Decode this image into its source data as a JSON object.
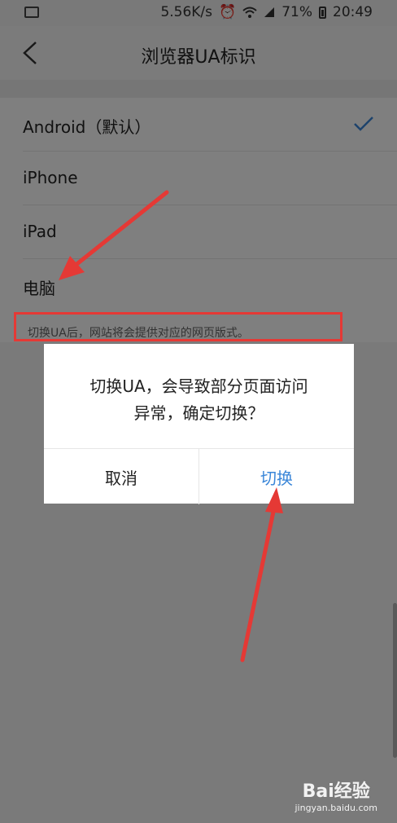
{
  "status_bar": {
    "speed": "5.56K/s",
    "battery_percent": "71%",
    "time": "20:49"
  },
  "header": {
    "title": "浏览器UA标识"
  },
  "ua_options": [
    {
      "label": "Android（默认）",
      "selected": true
    },
    {
      "label": "iPhone",
      "selected": false
    },
    {
      "label": "iPad",
      "selected": false
    },
    {
      "label": "电脑",
      "selected": false
    }
  ],
  "hint": "切换UA后，网站将会提供对应的网页版式。",
  "dialog": {
    "line1": "切换UA，会导致部分页面访问",
    "line2": "异常，确定切换？",
    "cancel_label": "取消",
    "confirm_label": "切换"
  },
  "watermark": {
    "brand": "Bai经验",
    "url": "jingyan.baidu.com"
  },
  "colors": {
    "accent": "#3a86d8",
    "annotation": "#e53935"
  }
}
